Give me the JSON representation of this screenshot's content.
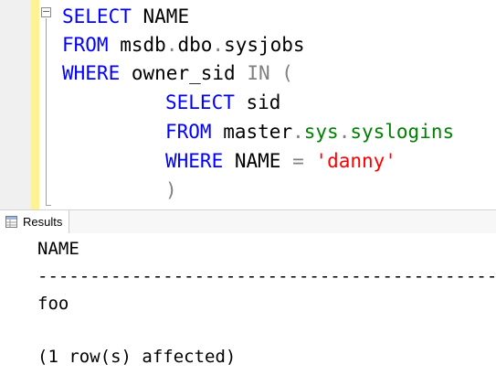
{
  "editor": {
    "line1": {
      "kw1": "SELECT",
      "id1": "NAME"
    },
    "line2": {
      "kw1": "FROM",
      "db": "msdb",
      "dot1": ".",
      "schema": "dbo",
      "dot2": ".",
      "obj": "sysjobs"
    },
    "line3": {
      "kw1": "WHERE",
      "id1": "owner_sid",
      "op1": "IN",
      "paren": "("
    },
    "line4": {
      "kw1": "SELECT",
      "id1": "sid"
    },
    "line5": {
      "kw1": "FROM",
      "db": "master",
      "dot1": ".",
      "schema": "sys",
      "dot2": ".",
      "obj": "syslogins"
    },
    "line6": {
      "kw1": "WHERE",
      "id1": "NAME",
      "op1": "=",
      "str": "'danny'"
    },
    "line7": {
      "paren": ")"
    }
  },
  "results": {
    "tab_label": "Results",
    "column_header": "NAME",
    "separator": "--------------------------------------------------------------",
    "rows": [
      "foo"
    ],
    "message": "(1 row(s) affected)"
  }
}
